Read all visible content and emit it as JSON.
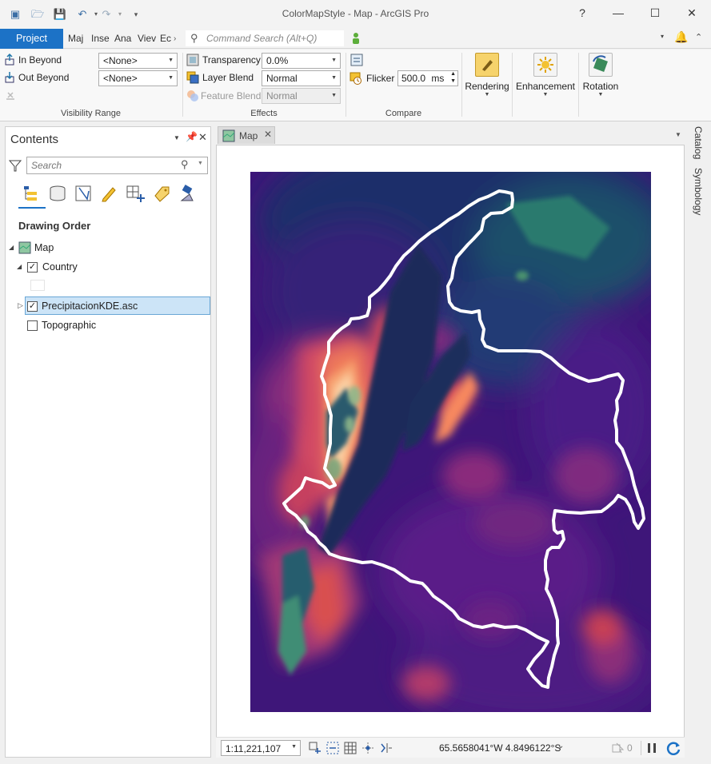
{
  "window": {
    "title": "ColorMapStyle - Map - ArcGIS Pro",
    "help": "?",
    "minimize": "—",
    "maximize": "☐",
    "close": "✕"
  },
  "tabs": [
    "Project",
    "Map",
    "Insert",
    "Analysis",
    "View",
    "Edit"
  ],
  "tabs_visible": [
    "Project",
    "Maj",
    "Inse",
    "Ana",
    "Viev",
    "Ec"
  ],
  "command_search": {
    "placeholder": "Command Search (Alt+Q)"
  },
  "ribbon": {
    "visibility": {
      "in_beyond": "In Beyond",
      "out_beyond": "Out Beyond",
      "in_beyond_value": "<None>",
      "out_beyond_value": "<None>",
      "group": "Visibility Range"
    },
    "effects": {
      "transparency": "Transparency",
      "transparency_value": "0.0%",
      "layer_blend": "Layer Blend",
      "layer_blend_value": "Normal",
      "feature_blend": "Feature Blend",
      "feature_blend_value": "Normal",
      "group": "Effects"
    },
    "compare": {
      "flicker": "Flicker",
      "flicker_value": "500.0",
      "flicker_unit": "ms",
      "group": "Compare"
    },
    "rendering": "Rendering",
    "enhancement": "Enhancement",
    "rotation": "Rotation"
  },
  "contents": {
    "title": "Contents",
    "search_placeholder": "Search",
    "drawing_order": "Drawing Order",
    "layers": [
      {
        "name": "Map"
      },
      {
        "name": "Country",
        "checked": true
      },
      {
        "name": "PrecipitacionKDE.asc",
        "checked": true,
        "selected": true
      },
      {
        "name": "Topographic",
        "checked": false
      }
    ]
  },
  "map_tab": {
    "label": "Map"
  },
  "status": {
    "scale": "1:11,221,107",
    "coordinates": "65.5658041°W 4.8496122°S",
    "selected_count": "0"
  },
  "right_dock": {
    "catalog": "Catalog",
    "symbology": "Symbology"
  },
  "colors": {
    "accent": "#1c72c6",
    "selection": "#cce4f7",
    "outline": "#ffffff"
  }
}
